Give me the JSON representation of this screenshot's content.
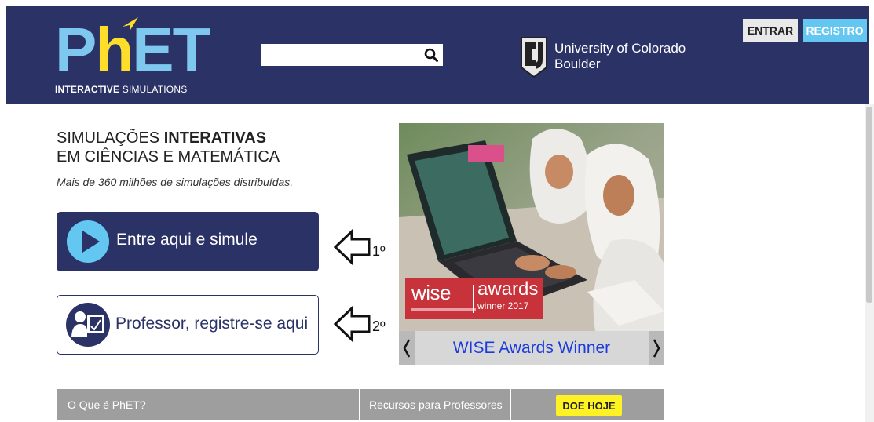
{
  "header": {
    "logo": {
      "mark_p": "P",
      "mark_h": "h",
      "mark_et": "ET",
      "sub_bold": "INTERACTIVE",
      "sub_rest": " SIMULATIONS"
    },
    "search": {
      "value": "",
      "placeholder": ""
    },
    "university": {
      "line1": "University of Colorado",
      "line2": "Boulder"
    },
    "login_label": "ENTRAR",
    "register_label": "REGISTRO"
  },
  "intro": {
    "title_line1_normal": "SIMULAÇÕES ",
    "title_line1_bold": "INTERATIVAS",
    "title_line2": "EM CIÊNCIAS E MATEMÁTICA",
    "stat": "Mais de 360 milhões de simulações distribuídas."
  },
  "cta": {
    "simulate_label": "Entre aqui e simule",
    "teacher_label": "Professor, registre-se aqui"
  },
  "annotations": {
    "step1": "1º",
    "step2": "2º"
  },
  "carousel": {
    "badge_word": "wise",
    "badge_awards": "awards",
    "badge_winner": "winner 2017",
    "caption": "WISE Awards Winner"
  },
  "nav": {
    "items": [
      {
        "label": "O Que é PhET?"
      },
      {
        "label": "Recursos para Professores"
      }
    ],
    "donate_label": "DOE HOJE"
  },
  "colors": {
    "brand_navy": "#2a3266",
    "brand_blue": "#63c7f2",
    "brand_yellow": "#fede2b",
    "wise_red": "#c8323a",
    "caption_link": "#1a3cdd"
  }
}
